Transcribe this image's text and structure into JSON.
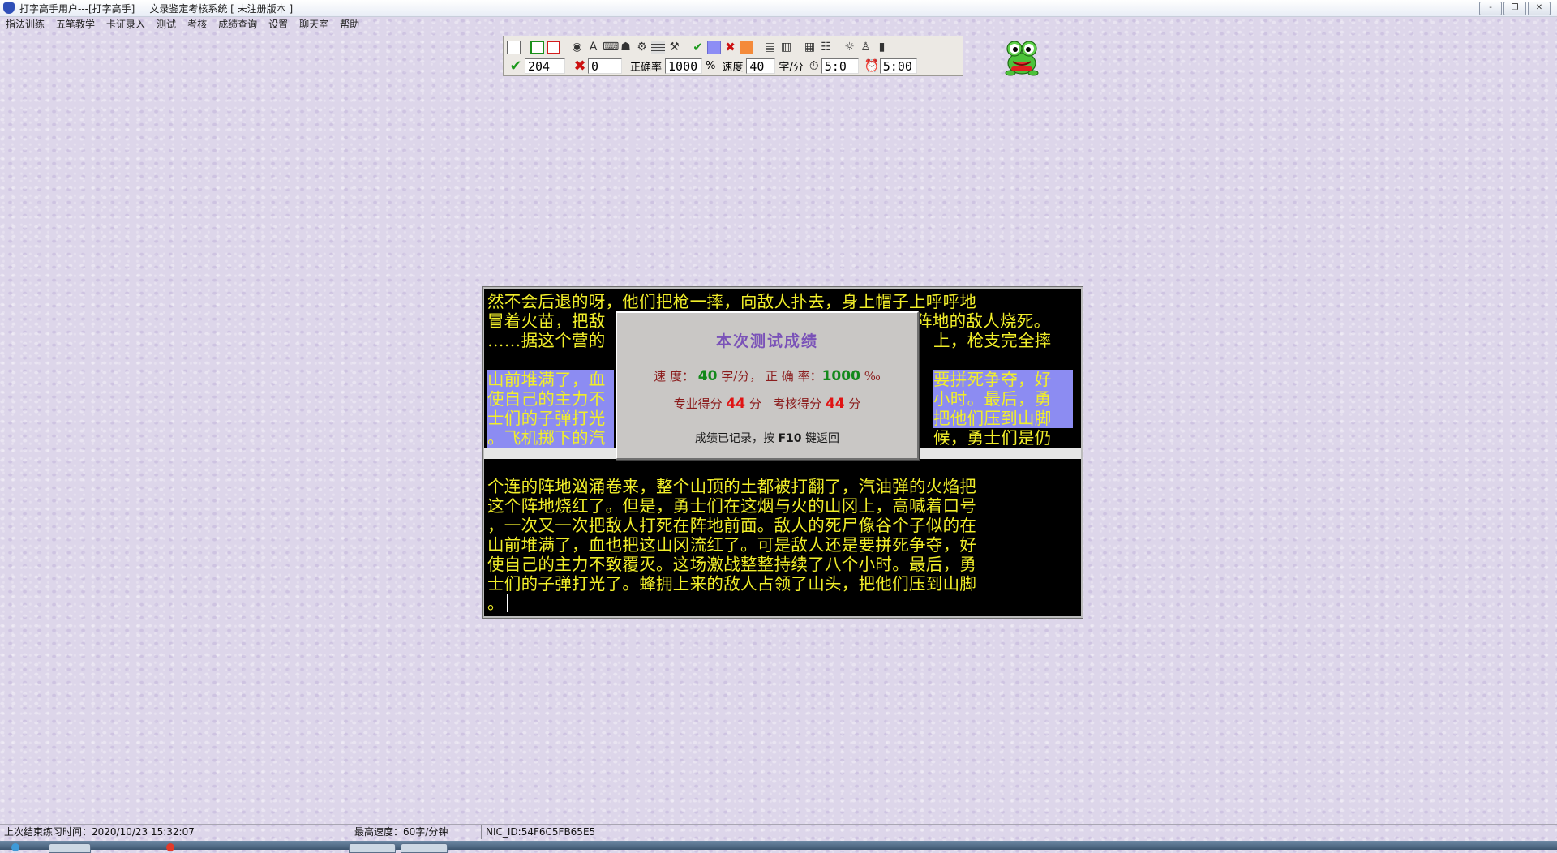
{
  "window": {
    "title": "打字高手用户---[打字高手]",
    "subtitle": "文录鉴定考核系统 [ 未注册版本 ]",
    "controls": [
      "-",
      "❐",
      "✕"
    ]
  },
  "menu": [
    "指法训练",
    "五笔教学",
    "卡证录入",
    "测试",
    "考核",
    "成绩查询",
    "设置",
    "聊天室",
    "帮助"
  ],
  "toolbar": {
    "correct_count": "204",
    "error_count": "0",
    "accuracy_label": "正确率",
    "accuracy_value": "1000",
    "accuracy_unit": "%",
    "speed_label": "速度",
    "speed_value": "40",
    "speed_unit": "字/分",
    "elapsed_time": "5:0",
    "limit_time": "5:00",
    "colors": {
      "correct_mark": "#8d8df5",
      "error_mark": "#f48a3a"
    }
  },
  "practice_text": {
    "lines": [
      "然不会后退的呀，他们把枪一摔，向敌人扑去，身上帽子上呼呼地",
      "冒着火苗，把敌",
      "阵地的敌人烧死。",
      "……据这个营的",
      "上，枪支完全摔",
      "山前堆满了，血",
      "要拼死争夺，好",
      "使自己的主力不",
      "小时。最后，勇",
      "士们的子弹打光",
      "把他们压到山脚",
      "。飞机掷下的汽",
      "候，勇士们是仍"
    ],
    "input_lines": [
      "个连的阵地汹涌卷来，整个山顶的土都被打翻了，汽油弹的火焰把",
      "这个阵地烧红了。但是，勇士们在这烟与火的山冈上，高喊着口号",
      "，一次又一次把敌人打死在阵地前面。敌人的死尸像谷个子似的在",
      "山前堆满了，血也把这山冈流红了。可是敌人还是要拼死争夺，好",
      "使自己的主力不致覆灭。这场激战整整持续了八个小时。最后，勇",
      "士们的子弹打光了。蜂拥上来的敌人占领了山头，把他们压到山脚",
      "。"
    ]
  },
  "result": {
    "title": "本次测试成绩",
    "speed_label": "速 度：",
    "speed_value": "40",
    "speed_unit": "字/分，",
    "accuracy_label": "正 确 率：",
    "accuracy_value": "1000",
    "accuracy_unit": "‰",
    "pro_score_label": "专业得分",
    "pro_score_value": "44",
    "pro_score_unit": "分",
    "exam_score_label": "考核得分",
    "exam_score_value": "44",
    "exam_score_unit": "分",
    "footer_pre": "成绩已记录，按",
    "footer_key": "F10",
    "footer_post": "键返回"
  },
  "status": {
    "last_practice": "上次结束练习时间：2020/10/23  15:32:07",
    "max_speed": "最高速度：60字/分钟",
    "nic_id": "NIC_ID:54F6C5FB65E5"
  }
}
